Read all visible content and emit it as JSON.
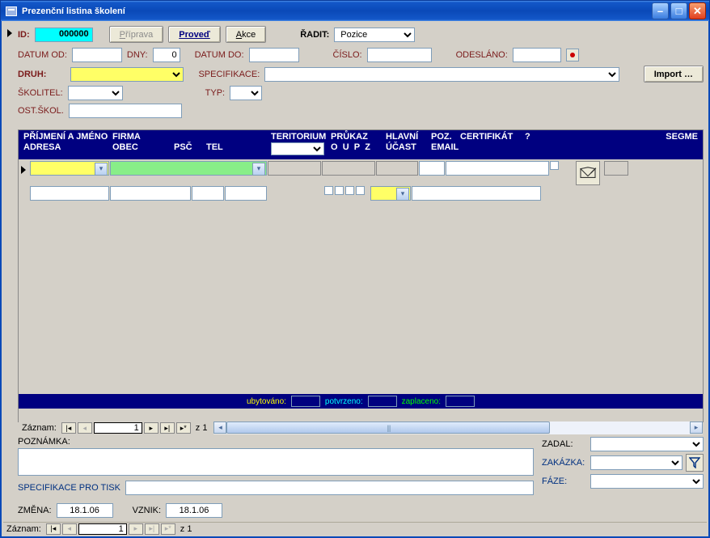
{
  "window": {
    "title": "Prezenční listina školení"
  },
  "toolbar": {
    "id_label": "ID:",
    "id_value": "000000",
    "btn_priprava": "Příprava",
    "btn_proved": "Proveď",
    "btn_akce": "Akce",
    "radit_label": "ŘADIT:",
    "radit_value": "Pozice",
    "btn_import": "Import …"
  },
  "form": {
    "datum_od_label": "DATUM OD:",
    "datum_od": "",
    "dny_label": "DNY:",
    "dny": "0",
    "datum_do_label": "DATUM DO:",
    "datum_do": "",
    "cislo_label": "ČÍSLO:",
    "cislo": "",
    "odeslano_label": "ODESLÁNO:",
    "odeslano": "",
    "druh_label": "DRUH:",
    "druh": "",
    "specifikace_label": "SPECIFIKACE:",
    "specifikace": "",
    "skolitel_label": "ŠKOLITEL:",
    "skolitel": "",
    "typ_label": "TYP:",
    "typ": "",
    "ostskol_label": "OST.ŠKOL.",
    "ostskol": ""
  },
  "grid": {
    "headers": {
      "prijmeni": "PŘÍJMENÍ A JMÉNO",
      "firma": "FIRMA",
      "adresa": "ADRESA",
      "obec": "OBEC",
      "psc": "PSČ",
      "tel": "TEL",
      "teritorium": "TERITORIUM",
      "prukaz": "PRŮKAZ",
      "o": "O",
      "u": "U",
      "p": "P",
      "z": "Z",
      "hlavni": "HLAVNÍ",
      "ucast": "ÚČAST",
      "poz": "POZ.",
      "certifikat": "CERTIFIKÁT",
      "email": "EMAIL",
      "qm": "?",
      "segme": "SEGME"
    },
    "footer": {
      "ubytovano": "ubytováno:",
      "potvrzeno": "potvrzeno:",
      "zaplaceno": "zaplaceno:"
    }
  },
  "recnav": {
    "label": "Záznam:",
    "num": "1",
    "of": "z  1"
  },
  "lower": {
    "poznamka_label": "POZNÁMKA:",
    "poznamka": "",
    "spec_tisk_label": "SPECIFIKACE PRO TISK",
    "spec_tisk": "",
    "zmena_label": "ZMĚNA:",
    "zmena": "18.1.06",
    "vznik_label": "VZNIK:",
    "vznik": "18.1.06",
    "zadal_label": "ZADAL:",
    "zadal": "",
    "zakazka_label": "ZAKÁZKA:",
    "zakazka": "",
    "faze_label": "FÁZE:",
    "faze": ""
  }
}
